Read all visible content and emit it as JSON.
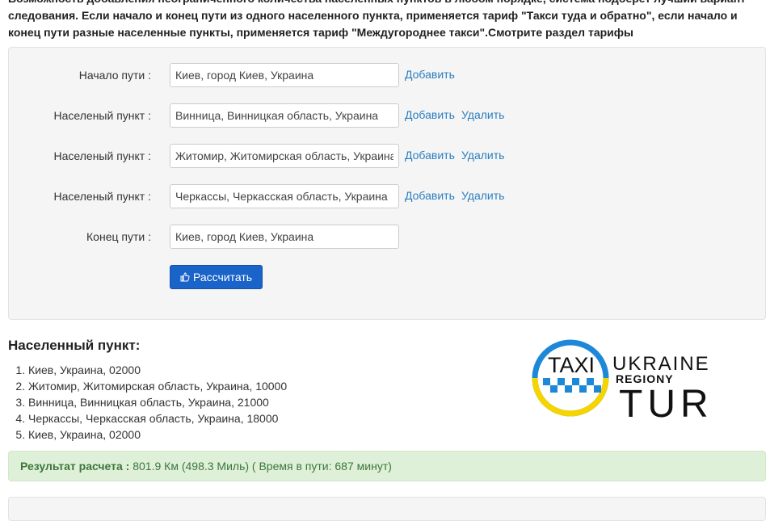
{
  "intro_text": "Возможность добавления неограниченного количества населенных пунктов в любом порядке, система подберет лучший вариант следования. Если начало и конец пути из одного населенного пункта, применяется тариф \"Такси туда и обратно\", если начало и конец пути разные населенные пункты, применяется тариф \"Междугороднее такси\".Смотрите раздел тарифы",
  "form": {
    "start": {
      "label": "Начало пути :",
      "value": "Киев, город Киев, Украина",
      "add": "Добавить"
    },
    "stops": [
      {
        "label": "Населеный пункт :",
        "value": "Винница, Винницкая область, Украина",
        "add": "Добавить",
        "remove": "Удалить"
      },
      {
        "label": "Населеный пункт :",
        "value": "Житомир, Житомирская область, Украина",
        "add": "Добавить",
        "remove": "Удалить"
      },
      {
        "label": "Населеный пункт :",
        "value": "Черкассы, Черкасская область, Украина",
        "add": "Добавить",
        "remove": "Удалить"
      }
    ],
    "end": {
      "label": "Конец пути :",
      "value": "Киев, город Киев, Украина"
    },
    "calculate_label": "Рассчитать"
  },
  "route": {
    "heading": "Населенный пункт:",
    "items": [
      "Киев, Украина, 02000",
      "Житомир, Житомирская область, Украина, 10000",
      "Винница, Винницкая область, Украина, 21000",
      "Черкассы, Черкасская область, Украина, 18000",
      "Киев, Украина, 02000"
    ]
  },
  "result": {
    "label": "Результат расчета :",
    "value": "801.9 Км (498.3 Миль) ( Время в пути: 687 минут)"
  },
  "logo": {
    "taxi": "TAXI",
    "ukraine": "UKRAINE",
    "regiony": "REGIONY",
    "tur": "TUR",
    "colors": {
      "blue": "#1e88d8",
      "yellow": "#f5d400",
      "dark": "#111111"
    }
  }
}
